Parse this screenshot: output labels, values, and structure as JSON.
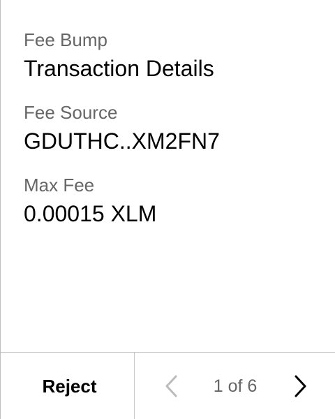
{
  "details": {
    "fields": [
      {
        "label": "Fee Bump",
        "value": "Transaction Details"
      },
      {
        "label": "Fee Source",
        "value": "GDUTHC..XM2FN7"
      },
      {
        "label": "Max Fee",
        "value": "0.00015 XLM"
      }
    ]
  },
  "footer": {
    "reject_label": "Reject",
    "pager": {
      "current_page": 1,
      "total_pages": 6,
      "text": "1 of 6",
      "prev_icon": "chevron-left-icon",
      "next_icon": "chevron-right-icon",
      "prev_enabled": false,
      "next_enabled": true
    }
  },
  "colors": {
    "primary_text": "#000000",
    "secondary_text": "#666666",
    "disabled_icon": "#bbbbbb",
    "divider": "#c7c7c7"
  }
}
